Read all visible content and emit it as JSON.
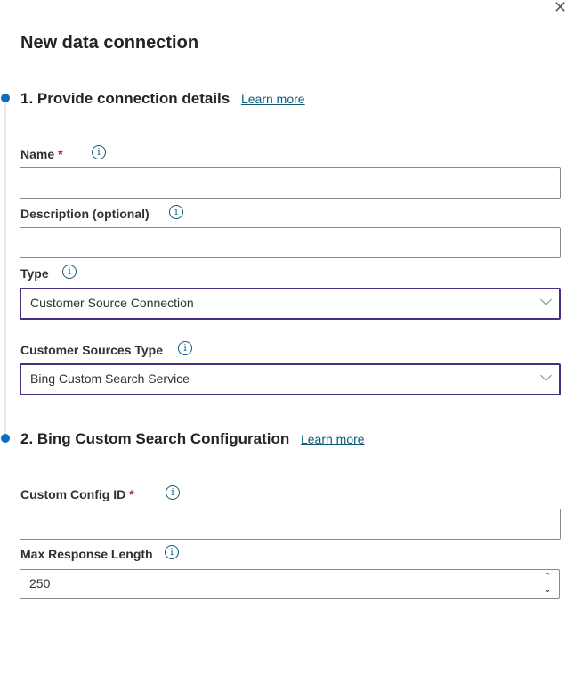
{
  "title": "New data connection",
  "close_icon": "close-icon",
  "section1": {
    "title": "1. Provide connection details",
    "learn_more": "Learn more"
  },
  "fields": {
    "name": {
      "label": "Name",
      "required": "*",
      "value": ""
    },
    "description": {
      "label": "Description (optional)",
      "value": ""
    },
    "type": {
      "label": "Type",
      "value": "Customer Source Connection"
    },
    "sources_type": {
      "label": "Customer Sources Type",
      "value": "Bing Custom Search Service"
    }
  },
  "section2": {
    "title": "2. Bing Custom Search Configuration",
    "learn_more": "Learn more"
  },
  "fields2": {
    "config_id": {
      "label": "Custom Config ID",
      "required": "*",
      "value": ""
    },
    "max_len": {
      "label": "Max Response Length",
      "value": "250"
    }
  },
  "info_glyph": "i",
  "colors": {
    "accent": "#0f6cbd",
    "select_border": "#4b2e83",
    "link": "#0f5c7a",
    "required": "#a4262c"
  }
}
